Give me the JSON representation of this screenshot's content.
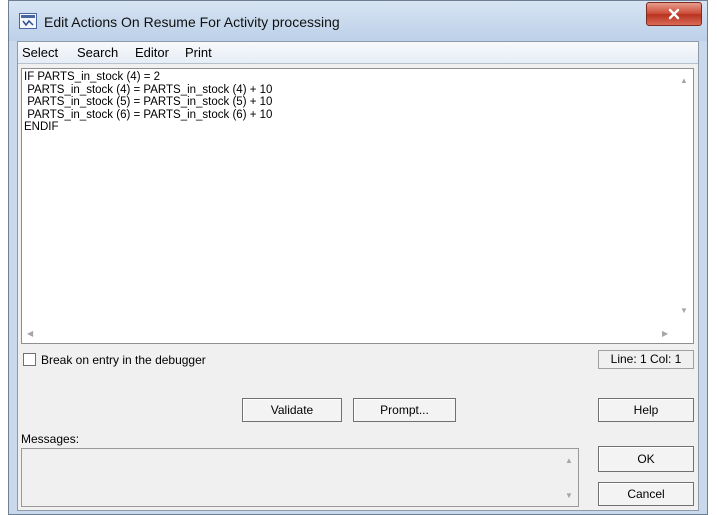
{
  "window": {
    "title": "Edit Actions On Resume For Activity processing",
    "close_label": "X"
  },
  "menu": [
    "Select",
    "Search",
    "Editor",
    "Print"
  ],
  "editor": {
    "code": "IF PARTS_in_stock (4) = 2\n PARTS_in_stock (4) = PARTS_in_stock (4) + 10\n PARTS_in_stock (5) = PARTS_in_stock (5) + 10\n PARTS_in_stock (6) = PARTS_in_stock (6) + 10\nENDIF"
  },
  "debugger_checkbox": {
    "label": "Break on entry in the debugger",
    "checked": false
  },
  "status": {
    "position": "Line: 1 Col: 1"
  },
  "buttons": {
    "validate": "Validate",
    "prompt": "Prompt...",
    "help": "Help",
    "ok": "OK",
    "cancel": "Cancel"
  },
  "messages": {
    "label": "Messages:",
    "content": ""
  },
  "colors": {
    "frame": "#c9d8ea",
    "close_button": "#c84c3a",
    "client": "#f0f0f0"
  }
}
